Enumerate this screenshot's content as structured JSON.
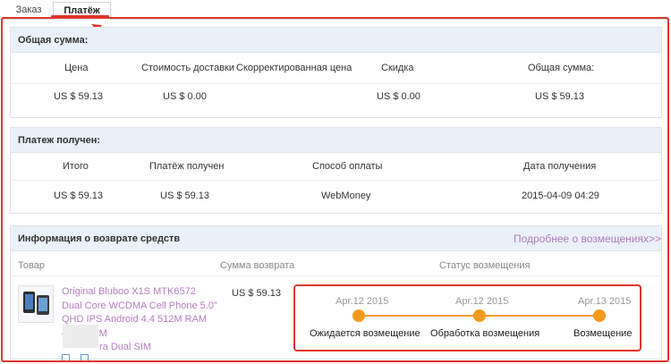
{
  "tabs": {
    "order": "Заказ",
    "payment": "Платёж"
  },
  "total": {
    "title": "Общая сумма:",
    "headers": [
      "Цена",
      "Стоимость доставки",
      "Скорректированная цена",
      "Скидка",
      "Общая сумма:"
    ],
    "values": [
      "US $ 59.13",
      "US $ 0.00",
      "",
      "US $ 0.00",
      "US $ 59.13"
    ]
  },
  "payment": {
    "title": "Платеж получен:",
    "headers": [
      "Итого",
      "Платёж получен",
      "Способ оплаты",
      "Дата получения"
    ],
    "values": [
      "US $ 59.13",
      "US $ 59.13",
      "WebMoney",
      "2015-04-09 04:29"
    ]
  },
  "refund": {
    "title": "Информация о возврате средств",
    "more_link": "Подробнее о возмещениях>>",
    "headers": {
      "product": "Товар",
      "amount": "Сумма возврата",
      "status": "Статус возмещения"
    },
    "product_title": "Original Bluboo X1S MTK6572 Dual Core WCDMA Cell Phone 5.0\" QHD IPS Android 4.4 512M RAM 4GB ROM",
    "product_title_tail": "ra Dual SIM",
    "amount": "US $ 59.13",
    "timeline": [
      {
        "date": "Apr.12 2015",
        "label": "Ожидается возмещение"
      },
      {
        "date": "Apr.12 2015",
        "label": "Обработка возмещения"
      },
      {
        "date": "Apr.13 2015",
        "label": "Возмещение"
      }
    ]
  },
  "colors": {
    "accent": "#f39a1d",
    "highlight": "#e0352b",
    "link": "#b47bbe",
    "header_bg": "#eaf1f8"
  }
}
